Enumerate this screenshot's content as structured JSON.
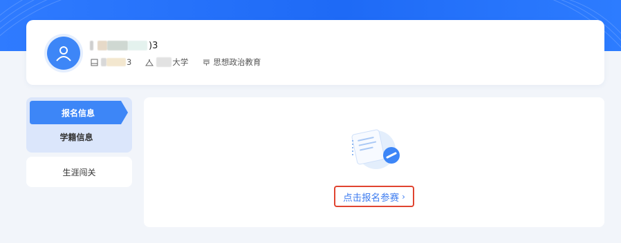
{
  "profile": {
    "name_suffix": ")3",
    "id_suffix": "3",
    "school_suffix": "大学",
    "major": "思想政治教育"
  },
  "sidebar": {
    "items": [
      {
        "label": "报名信息",
        "active": true
      },
      {
        "label": "学籍信息",
        "active": false
      },
      {
        "label": "生涯闯关",
        "active": false
      }
    ]
  },
  "main": {
    "signup_link": "点击报名参赛",
    "signup_chevron": "›"
  },
  "colors": {
    "banner": "#1e6af6",
    "accent": "#3d86f7",
    "highlight_border": "#e0432f"
  }
}
